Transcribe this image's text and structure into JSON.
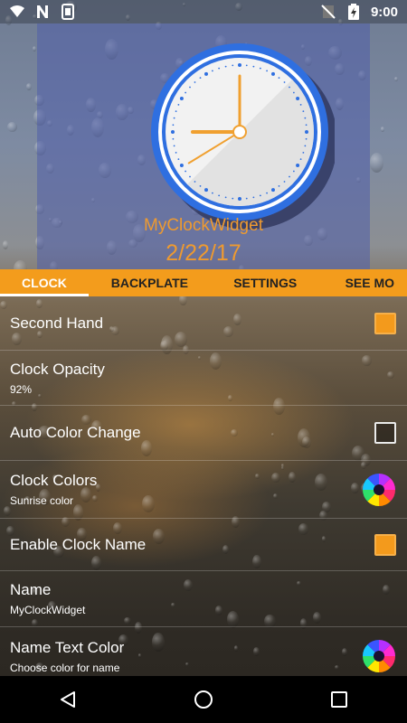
{
  "status_bar": {
    "time": "9:00",
    "icons_left": [
      "wifi-icon",
      "n-notification-icon",
      "sim-card-icon"
    ],
    "icons_right": [
      "no-sim-icon",
      "battery-charging-icon"
    ]
  },
  "widget_preview": {
    "name": "MyClockWidget",
    "date": "2/22/17",
    "clock_time": "9:00",
    "colors": {
      "ring": "#2f6fe0",
      "hands": "#f0a030",
      "text": "#ee9a30"
    }
  },
  "tabs": [
    {
      "label": "CLOCK",
      "active": true
    },
    {
      "label": "BACKPLATE",
      "active": false
    },
    {
      "label": "SETTINGS",
      "active": false
    },
    {
      "label": "SEE MO",
      "active": false
    }
  ],
  "settings": [
    {
      "title": "Second Hand",
      "control": "checkbox",
      "checked": true
    },
    {
      "title": "Clock Opacity",
      "subtitle": "92%",
      "control": "none"
    },
    {
      "title": "Auto Color Change",
      "control": "checkbox",
      "checked": false
    },
    {
      "title": "Clock Colors",
      "subtitle": "Sunrise color",
      "control": "color-swatch"
    },
    {
      "title": "Enable Clock Name",
      "control": "checkbox",
      "checked": true
    },
    {
      "title": "Name",
      "subtitle": "MyClockWidget",
      "control": "none"
    },
    {
      "title": "Name Text Color",
      "subtitle": "Choose color for name",
      "control": "color-swatch"
    }
  ],
  "nav_bar": [
    "back-icon",
    "home-icon",
    "recents-icon"
  ],
  "accent_color": "#f39c1c"
}
